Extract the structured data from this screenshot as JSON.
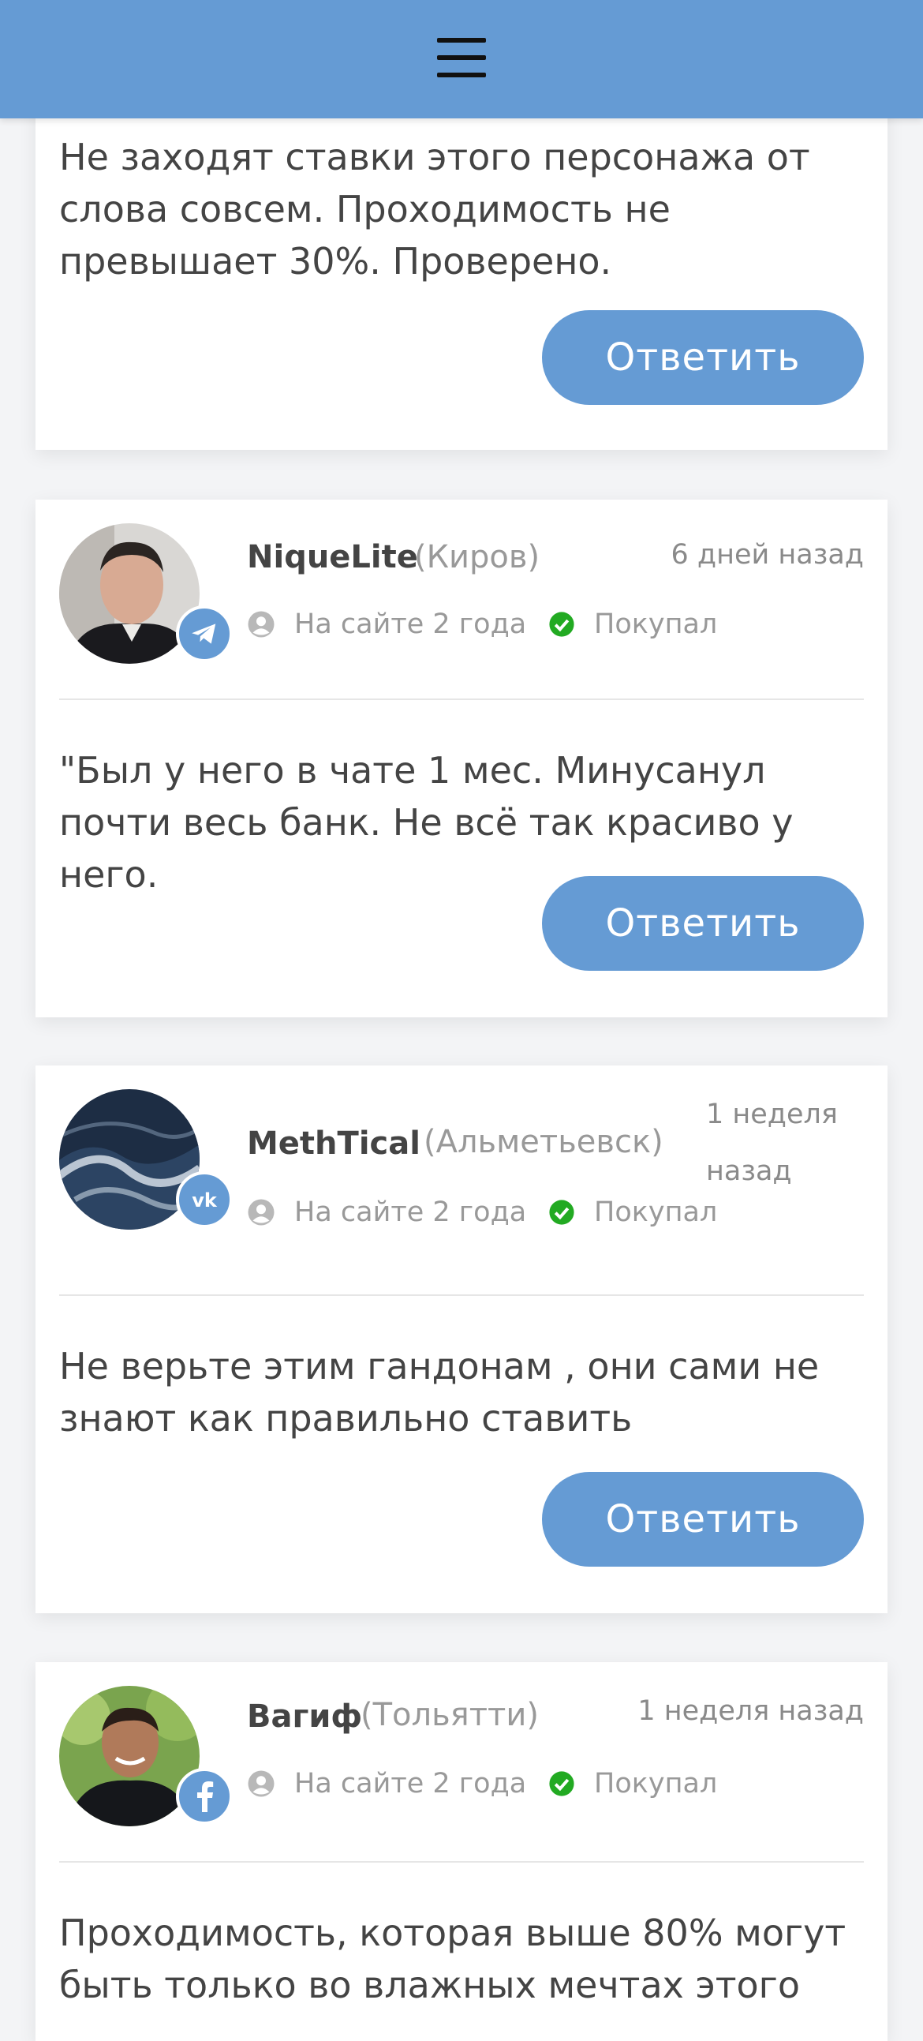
{
  "header": {
    "menu_icon": "hamburger-menu-icon",
    "background": "#659bd4"
  },
  "reply_label": "Ответить",
  "comments": [
    {
      "text": "Не заходят ставки этого персонажа от слова совсем. Проходимость не превышает 30%. Проверено."
    },
    {
      "name": "NiqueLite",
      "city": "(Киров)",
      "date": "6 дней назад",
      "on_site": "На сайте 2 года",
      "status": "Покупал",
      "social": "telegram-icon",
      "text": "\"Был у него в чате 1 мес. Минусанул почти весь банк. Не всё так красиво у него."
    },
    {
      "name": "MethTical",
      "city": "(Альметьевск)",
      "date": "1 неделя назад",
      "on_site": "На сайте 2 года",
      "status": "Покупал",
      "social": "vk-icon",
      "text": "Не верьте этим гандонам , они сами не знают как правильно ставить"
    },
    {
      "name": "Вагиф",
      "city": "(Тольятти)",
      "date": "1 неделя назад",
      "on_site": "На сайте 2 года",
      "status": "Покупал",
      "social": "facebook-icon",
      "text": "Проходимость, которая выше 80% могут быть только во влажных мечтах этого"
    }
  ],
  "colors": {
    "accent": "#659bd4",
    "check": "#22aa22",
    "muted": "#999999"
  }
}
